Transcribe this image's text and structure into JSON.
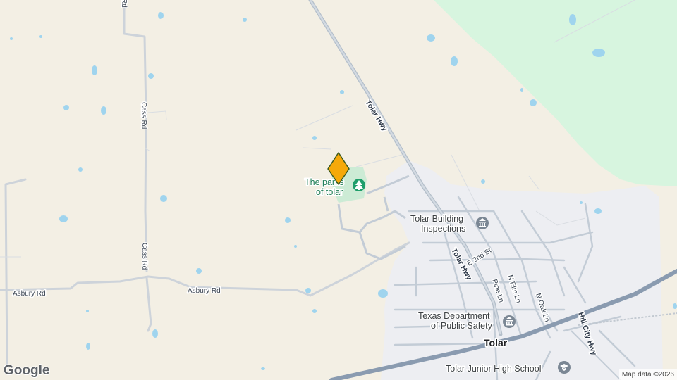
{
  "roads": {
    "tolar_hwy_upper": "Tolar Hwy",
    "tolar_hwy_lower": "Tolar Hwy",
    "cass_rd_upper": "Cass Rd",
    "cass_rd_lower": "Cass Rd",
    "asbury_rd_left": "Asbury Rd",
    "asbury_rd_right": "Asbury Rd",
    "hill_city_hwy": "Hill City Hwy",
    "e_2nd_st": "E 2nd St",
    "pine_ln": "Pine Ln",
    "n_elm_ln": "N Elm Ln",
    "n_oak_ln": "N Oak Ln",
    "top_rd_fragment": "Rd"
  },
  "places": {
    "park_line1": "The parks",
    "park_line2": "of tolar",
    "building_insp_line1": "Tolar Building",
    "building_insp_line2": "Inspections",
    "dps_line1": "Texas Department",
    "dps_line2": "of Public Safety",
    "town": "Tolar",
    "school": "Tolar Junior High School"
  },
  "icons": {
    "park": "tree-icon",
    "government": "government-building-icon",
    "school": "graduation-cap-icon",
    "marker": "location-marker-icon"
  },
  "colors": {
    "land": "#f3efe4",
    "forest": "#d7f5df",
    "water": "#9fd4ee",
    "road": "#c3ccd6",
    "highway": "#8a9bb0",
    "urban": "#edeef2",
    "marker": "#f5a90a",
    "park_icon": "#1e9e6a",
    "gov_icon": "#7b8794"
  },
  "branding": {
    "logo": "Google",
    "attribution": "Map data ©2026"
  }
}
